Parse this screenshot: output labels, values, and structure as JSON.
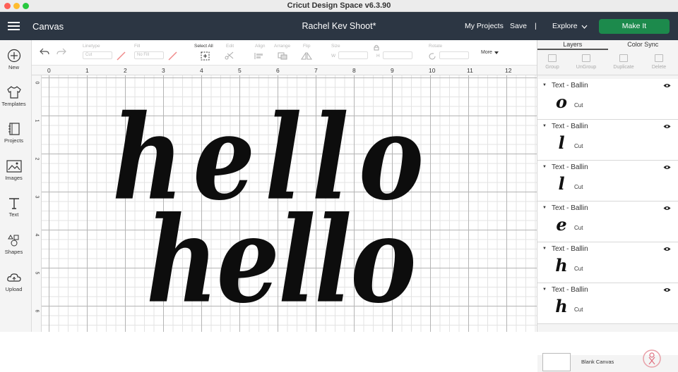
{
  "window": {
    "title": "Cricut Design Space  v6.3.90"
  },
  "header": {
    "canvas_label": "Canvas",
    "project_name": "Rachel Kev Shoot*",
    "my_projects": "My Projects",
    "save": "Save",
    "separator": "|",
    "explore": "Explore",
    "make_it": "Make It"
  },
  "sidebar": {
    "items": [
      {
        "label": "New",
        "icon": "plus-circle-icon"
      },
      {
        "label": "Templates",
        "icon": "tshirt-icon"
      },
      {
        "label": "Projects",
        "icon": "notebook-icon"
      },
      {
        "label": "Images",
        "icon": "image-icon"
      },
      {
        "label": "Text",
        "icon": "text-t-icon"
      },
      {
        "label": "Shapes",
        "icon": "shapes-icon"
      },
      {
        "label": "Upload",
        "icon": "cloud-upload-icon"
      }
    ]
  },
  "toolbar": {
    "linetype_label": "Linetype",
    "linetype_value": "Cut",
    "fill_label": "Fill",
    "fill_value": "No Fill",
    "select_all": "Select All",
    "edit": "Edit",
    "align": "Align",
    "arrange": "Arrange",
    "flip": "Flip",
    "size": "Size",
    "size_w": "W",
    "size_h": "H",
    "rotate": "Rotate",
    "more": "More"
  },
  "ruler": {
    "top": [
      "0",
      "1",
      "2",
      "3",
      "4",
      "5",
      "6",
      "7",
      "8",
      "9",
      "10",
      "11",
      "12"
    ],
    "left": [
      "0",
      "1",
      "2",
      "3",
      "4",
      "5",
      "6"
    ]
  },
  "canvas": {
    "text_top": "hello",
    "text_bottom": "hello"
  },
  "panel": {
    "tabs": [
      "Layers",
      "Color Sync"
    ],
    "active_tab": "Layers",
    "actions": [
      "Group",
      "UnGroup",
      "Duplicate",
      "Delete"
    ],
    "layers": [
      {
        "name": "Text - Ballin",
        "glyph": "o",
        "op": "Cut"
      },
      {
        "name": "Text - Ballin",
        "glyph": "l",
        "op": "Cut"
      },
      {
        "name": "Text - Ballin",
        "glyph": "l",
        "op": "Cut"
      },
      {
        "name": "Text - Ballin",
        "glyph": "e",
        "op": "Cut"
      },
      {
        "name": "Text - Ballin",
        "glyph": "h",
        "op": "Cut"
      },
      {
        "name": "Text - Ballin",
        "glyph": "h",
        "op": "Cut"
      }
    ],
    "blank_canvas": "Blank Canvas"
  },
  "colors": {
    "header_bg": "#2c3643",
    "make_it": "#1c8a4c",
    "traffic": [
      "#fe5f57",
      "#febc2e",
      "#28c840"
    ]
  }
}
